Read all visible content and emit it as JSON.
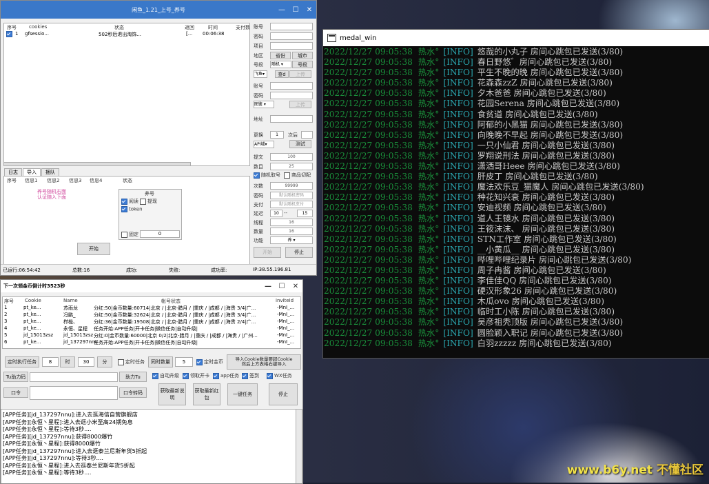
{
  "watermark": {
    "url": "www.b6y.net",
    "site": "不懂社区"
  },
  "w1": {
    "title": "闲鱼_1.21_上号_养号",
    "columns": [
      "序号",
      "cookies",
      "状态",
      "返回",
      "时间",
      "支付数"
    ],
    "row": {
      "index": "1",
      "cookie": "gfsessio...",
      "status": "502秒后退出淘饰...",
      "ret": "[...",
      "time": "00:06:38"
    },
    "tabs": [
      "日志",
      "导入",
      "捆队"
    ],
    "sub_columns": [
      "序号",
      "信息1",
      "信息2",
      "信息3",
      "信息4",
      "状态"
    ],
    "hint_line1": "养号随机右面",
    "hint_line2": "认证随入下面",
    "yang_title": "养号",
    "opt_yuedu": "阅读",
    "opt_tiqian": "提现",
    "opt_token": "token",
    "opt_guding": "固定",
    "guding_value": "0",
    "start_button": "开始",
    "right": {
      "zhanghao": "账号",
      "mima": "密码",
      "xiangmu": "项目",
      "diqu": "地区",
      "shengfen": "省份",
      "chengshi": "城市",
      "haoduan": "号段",
      "haoduan_val": "随机",
      "haohao": "号段",
      "feiyu": "飞鱼",
      "chaxun": "查d",
      "shangchuan": "上传",
      "zhanghao2": "账号",
      "mima2": "密码",
      "tubiao": "图鉴",
      "shangchuan2": "上传",
      "dizhi": "地址",
      "genghuan": "更换",
      "genghuan_val": "1",
      "cishu": "次后",
      "api_label": "API域",
      "ceshi": "测试",
      "tiwen": "提文",
      "tiwen_val": "100",
      "shuliang": "数目",
      "shuliang_val": "25",
      "suiji_qu": "随机取号",
      "suiji_qu2": "商品切配",
      "cishu2": "次数",
      "cishu2_val": "99999",
      "mima3": "密码",
      "mima3_val": "默认随机密码",
      "zhifu": "支付",
      "zhifu_val": "默认随机支付",
      "yanchi": "延迟",
      "yanchi_a": "10",
      "yanchi_sep": "--",
      "yanchi_b": "15",
      "xiancheng": "线程",
      "xiancheng_val": "16",
      "shuliang2": "数量",
      "shuliang2_val": "16",
      "gongneng": "功能",
      "gongneng_val": "养",
      "start": "开始",
      "stop": "停止"
    },
    "status": {
      "elapsed": "已运行:06:54:42",
      "total": "总数:16",
      "success": "成功:",
      "fail": "失败:",
      "succ_rate": "成功率:",
      "ip": "IP:38.55.196.81"
    }
  },
  "w2": {
    "title": "下一次领金币倒计时3523秒",
    "columns": [
      "序号",
      "Cookie",
      "Name",
      "帐号状态",
      "inviteId"
    ],
    "rows": [
      {
        "i": "1",
        "c": "pt_ke...",
        "n": "苏雨龙",
        "s": "分红:50|金币数量:60714|北京 / |北京-腊月 / |重庆 / |成都 / |海贵 3/4|广...",
        "v": "-MnI_..."
      },
      {
        "i": "2",
        "c": "pt_ke...",
        "n": "冯鹏_",
        "s": "分红:50|金币数量:32624|北京 / |北京-腊月 / |重庆 / |成都 / |海贵 3/4|广...",
        "v": "-MnI_..."
      },
      {
        "i": "3",
        "c": "pt_ke...",
        "n": "栉栊、",
        "s": "分红:36|金币数量:19508|北京 / |北京-腊月 / |重庆 / |成都 / |海贵 2/4|广...",
        "v": "-MnI_..."
      },
      {
        "i": "4",
        "c": "pt_ke...",
        "n": "永恒、星程",
        "s": "任务开始:APP任务|开卡任务|微信任务|自动升级|",
        "v": "-MnI_..."
      },
      {
        "i": "5",
        "c": "jd_15013zsz",
        "n": "jd_15013zsz",
        "s": "分红:0|金币数量:60000|北京 0/2|北京-腊月 / |重庆 / |成都 / |海贵 / |广州...",
        "v": "-MnI_..."
      },
      {
        "i": "6",
        "c": "pt_ke...",
        "n": "jd_137297nnu",
        "s": "任务开始:APP任务|开卡任务|微信任务|自动升级|",
        "v": "-MnI_..."
      }
    ],
    "timed_exec": "定时执行任务",
    "hours": "8",
    "hour_btn": "时",
    "mins": "30",
    "min_btn": "分",
    "timed_task": "定时任务",
    "sync_count": "同时数量",
    "sync_val": "5",
    "timed_gold": "定时金币",
    "import_cookie": "导入Cookie数量要超Cookie\n然后上方表格右键导入",
    "tu_help": "Tu助力码",
    "help_tu": "助力Tu",
    "kouling": "口令",
    "kouling_transfer": "口令转码",
    "auto_upgrade": "自动升级",
    "collect_card": "领取开卡",
    "app_task": "app任务",
    "sign": "签到",
    "wx_task": "WX任务",
    "get_newest1": "获取最新说明",
    "get_newest2": "获取最新红包",
    "one_key": "一键任务",
    "stop": "停止",
    "log": [
      "[APP任务][jd_137297nnu]:进入去逛海信自营旗舰店",
      "[APP任务][永恒丶星程]:进入去逛小米至高24期免息",
      "[APP任务][永恒丶星程]:等待3秒....",
      "[APP任务][jd_137297nnu]:获得8000爆竹",
      "[APP任务][永恒丶星程]:获得8000爆竹",
      "[APP任务][jd_137297nnu]:进入去逛泰兰尼斯年货5折起",
      "[APP任务][jd_137297nnu]:等待3秒....",
      "[APP任务][永恒丶星程]:进入去逛泰兰尼斯年货5折起",
      "[APP任务][永恒丶星程]:等待3秒...."
    ]
  },
  "w3": {
    "title": "medal_win",
    "timestamp": "2022/12/27 09:05:38",
    "tag": "热水°",
    "level": "[INFO]",
    "lines": [
      "悠哉的小丸子 房间心跳包已发送(3/80)",
      "春日野悠゛房间心跳包已发送(3/80)",
      "平生不晚的晚 房间心跳包已发送(3/80)",
      "花森森zzZ 房间心跳包已发送(3/80)",
      "夕木爸爸 房间心跳包已发送(3/80)",
      "花园Serena 房间心跳包已发送(3/80)",
      "食贫道 房间心跳包已发送(3/80)",
      "阿郁的小黑猫 房间心跳包已发送(3/80)",
      "向晚晚不早起 房间心跳包已发送(3/80)",
      "一只小仙君 房间心跳包已发送(3/80)",
      "罗翔说刑法 房间心跳包已发送(3/80)",
      "潇洒哥Heee 房间心跳包已发送(3/80)",
      "肝皮丁 房间心跳包已发送(3/80)",
      "魔法欢乐豆_猫魔人 房间心跳包已发送(3/80)",
      "种花知兴衰 房间心跳包已发送(3/80)",
      "安迪视频 房间心跳包已发送(3/80)",
      "道人王镜水 房间心跳包已发送(3/80)",
      "王筱沫沫、 房间心跳包已发送(3/80)",
      "STN工作室 房间心跳包已发送(3/80)",
      "__小黄瓜__ 房间心跳包已发送(3/80)",
      "哔哩哔哩纪录片 房间心跳包已发送(3/80)",
      "周子冉酱 房间心跳包已发送(3/80)",
      "李佳佳QQ 房间心跳包已发送(3/80)",
      "硬汉形象26 房间心跳包已发送(3/80)",
      "木瓜ovo 房间心跳包已发送(3/80)",
      "临时工小陈 房间心跳包已发送(3/80)",
      "吴彦祖秃顶版 房间心跳包已发送(3/80)",
      "圆脸颖入职记 房间心跳包已发送(3/80)",
      "白羽zzzzz 房间心跳包已发送(3/80)"
    ]
  }
}
